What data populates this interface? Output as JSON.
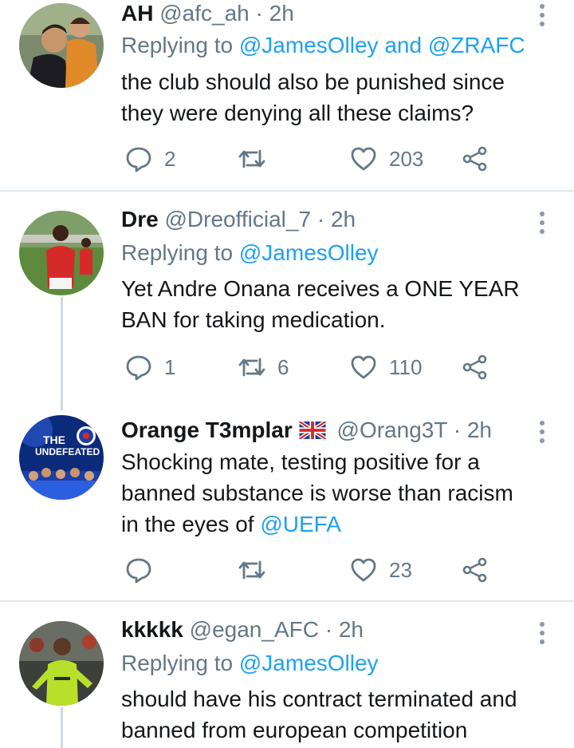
{
  "colors": {
    "link": "#1da1f2",
    "muted": "#657786",
    "text": "#14171a",
    "divider": "#e1e8ed"
  },
  "tweets": [
    {
      "name": "AH",
      "handle": "@afc_ah",
      "separator": "·",
      "time": "2h",
      "replying_prefix": "Replying to",
      "replying_mentions": [
        "@JamesOlley",
        "@ZRAFC"
      ],
      "replying_joiner": "and",
      "text_lines": [
        "the club should also be punished since",
        "they were denying all these claims?"
      ],
      "reply_count": "2",
      "retweet_count": "",
      "like_count": "203"
    },
    {
      "name": "Dre",
      "handle": "@Dreofficial_7",
      "separator": "·",
      "time": "2h",
      "replying_prefix": "Replying to",
      "replying_mentions": [
        "@JamesOlley"
      ],
      "text_lines": [
        "Yet Andre Onana receives a ONE YEAR",
        "BAN for taking medication."
      ],
      "reply_count": "1",
      "retweet_count": "6",
      "like_count": "110"
    },
    {
      "name": "Orange T3mplar",
      "handle": "@Orang3T",
      "separator": "·",
      "time": "2h",
      "avatar_text": [
        "THE",
        "UNDEFEATED"
      ],
      "text_lines": [
        "Shocking mate, testing positive for a",
        "banned substance is worse than racism"
      ],
      "text_last_prefix": "in the eyes of",
      "text_last_mention": "@UEFA",
      "reply_count": "",
      "retweet_count": "",
      "like_count": "23"
    },
    {
      "name": "kkkkk",
      "handle": "@egan_AFC",
      "separator": "·",
      "time": "2h",
      "replying_prefix": "Replying to",
      "replying_mentions": [
        "@JamesOlley"
      ],
      "text_lines": [
        "should have his contract terminated and",
        "banned from european competition"
      ]
    }
  ]
}
